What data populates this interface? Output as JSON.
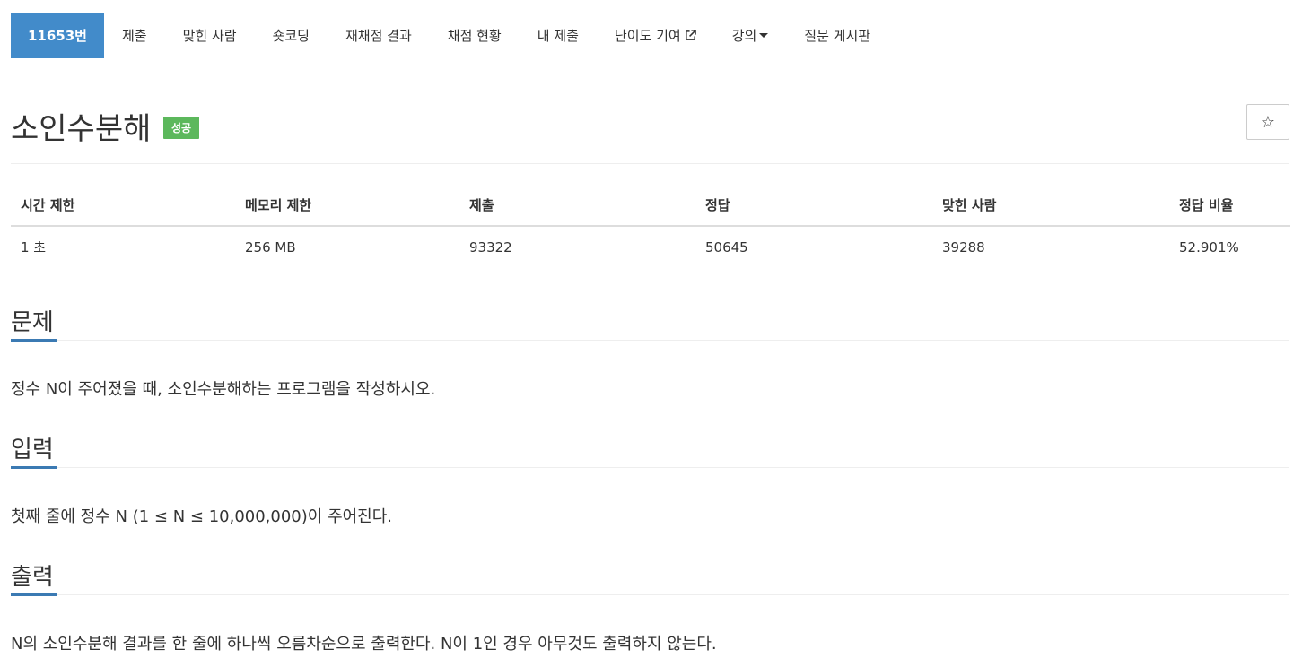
{
  "nav": {
    "items": [
      {
        "label": "11653번",
        "active": true
      },
      {
        "label": "제출"
      },
      {
        "label": "맞힌 사람"
      },
      {
        "label": "숏코딩"
      },
      {
        "label": "재채점 결과"
      },
      {
        "label": "채점 현황"
      },
      {
        "label": "내 제출"
      },
      {
        "label": "난이도 기여",
        "icon": "external-link-icon"
      },
      {
        "label": "강의",
        "icon": "caret-down-icon"
      },
      {
        "label": "질문 게시판"
      }
    ]
  },
  "problem": {
    "title": "소인수분해",
    "badge": "성공",
    "badge_color": "#5cb85c",
    "star_icon": "star-outline-icon",
    "star_glyph": "☆"
  },
  "info_table": {
    "headers": [
      "시간 제한",
      "메모리 제한",
      "제출",
      "정답",
      "맞힌 사람",
      "정답 비율"
    ],
    "values": [
      "1 초",
      "256 MB",
      "93322",
      "50645",
      "39288",
      "52.901%"
    ]
  },
  "sections": [
    {
      "heading": "문제",
      "body": "정수 N이 주어졌을 때, 소인수분해하는 프로그램을 작성하시오."
    },
    {
      "heading": "입력",
      "body": "첫째 줄에 정수 N (1 ≤ N ≤ 10,000,000)이 주어진다."
    },
    {
      "heading": "출력",
      "body": "N의 소인수분해 결과를 한 줄에 하나씩 오름차순으로 출력한다. N이 1인 경우 아무것도 출력하지 않는다."
    }
  ],
  "colors": {
    "accent": "#428bca",
    "section_underline": "#3b7ab3"
  }
}
